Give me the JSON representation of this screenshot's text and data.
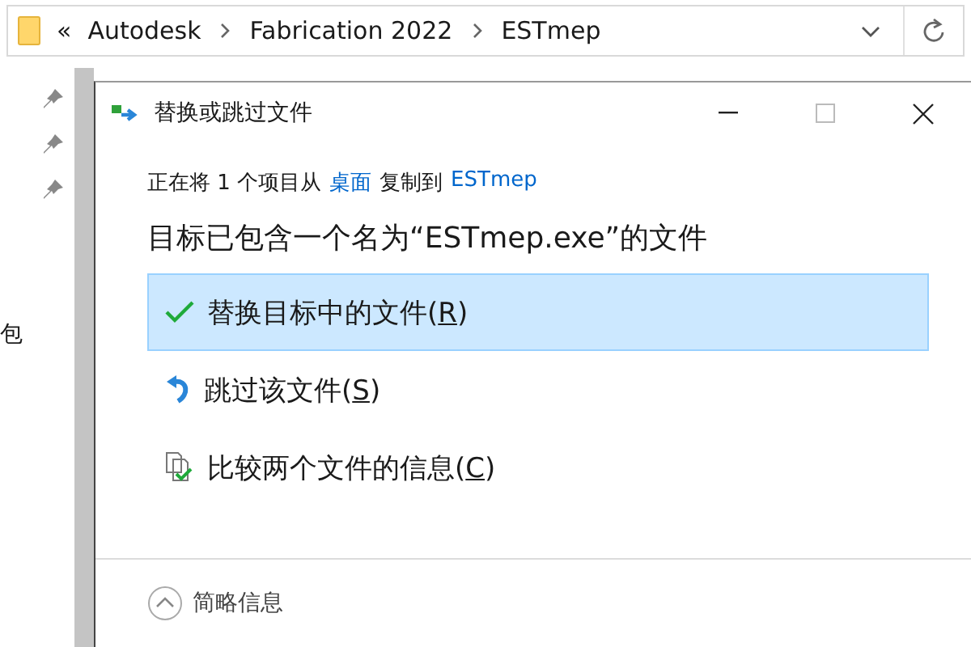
{
  "explorer": {
    "overflow": "«",
    "breadcrumb": [
      "Autodesk",
      "Fabrication 2022",
      "ESTmep"
    ],
    "side_text": "包"
  },
  "dialog": {
    "title": "替换或跳过文件",
    "status": [
      {
        "kind": "text",
        "text": "正在将 1 个项目从"
      },
      {
        "kind": "link",
        "text": "桌面"
      },
      {
        "kind": "text",
        "text": "复制到"
      },
      {
        "kind": "link",
        "text": "ESTmep"
      }
    ],
    "heading": "目标已包含一个名为“ESTmep.exe”的文件",
    "options": [
      {
        "kind": "replace",
        "text": "替换目标中的文件(",
        "key": "R",
        "end": ")",
        "selected": true
      },
      {
        "kind": "skip",
        "text": "跳过该文件(",
        "key": "S",
        "end": ")",
        "selected": false
      },
      {
        "kind": "compare",
        "text": "比较两个文件的信息(",
        "key": "C",
        "end": ")",
        "selected": false
      }
    ],
    "footer": "简略信息"
  }
}
